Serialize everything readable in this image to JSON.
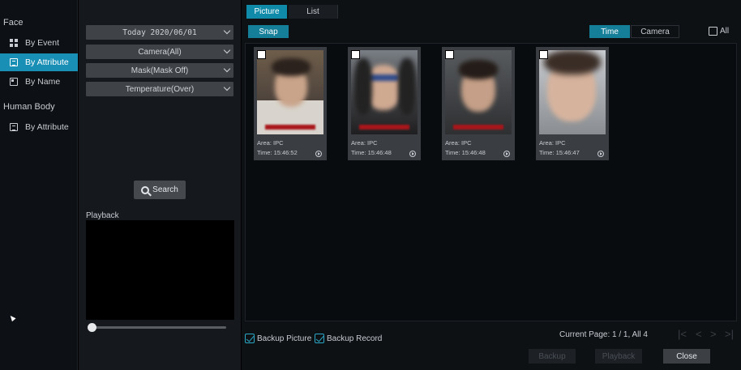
{
  "sidebar": {
    "face_group": "Face",
    "face_items": [
      {
        "label": "By Event",
        "icon": "grid-icon"
      },
      {
        "label": "By Attribute",
        "icon": "document-icon",
        "active": true
      },
      {
        "label": "By Name",
        "icon": "id-card-icon"
      }
    ],
    "human_group": "Human Body",
    "human_items": [
      {
        "label": "By Attribute",
        "icon": "document-icon"
      }
    ]
  },
  "filters": {
    "date": "Today 2020/06/01",
    "camera": "Camera(All)",
    "mask": "Mask(Mask Off)",
    "temperature": "Temperature(Over)",
    "search_label": "Search",
    "playback_label": "Playback"
  },
  "tabs": [
    "Picture",
    "List"
  ],
  "toolbar": {
    "snap_label": "Snap",
    "time_label": "Time",
    "camera_label": "Camera",
    "all_label": "All"
  },
  "results": [
    {
      "area_label": "Area:",
      "area": "IPC",
      "time_label": "Time:",
      "time": "15:46:52"
    },
    {
      "area_label": "Area:",
      "area": "IPC",
      "time_label": "Time:",
      "time": "15:46:48"
    },
    {
      "area_label": "Area:",
      "area": "IPC",
      "time_label": "Time:",
      "time": "15:46:48"
    },
    {
      "area_label": "Area:",
      "area": "IPC",
      "time_label": "Time:",
      "time": "15:46:47"
    }
  ],
  "footer": {
    "backup_picture": "Backup Picture",
    "backup_record": "Backup Record",
    "page_info": "Current Page: 1 / 1, All 4",
    "backup_button": "Backup",
    "playback_button": "Playback",
    "close_button": "Close"
  },
  "colors": {
    "accent": "#157e98",
    "nav_active": "#1a8fb5",
    "overlay_red": "#a8161a"
  }
}
